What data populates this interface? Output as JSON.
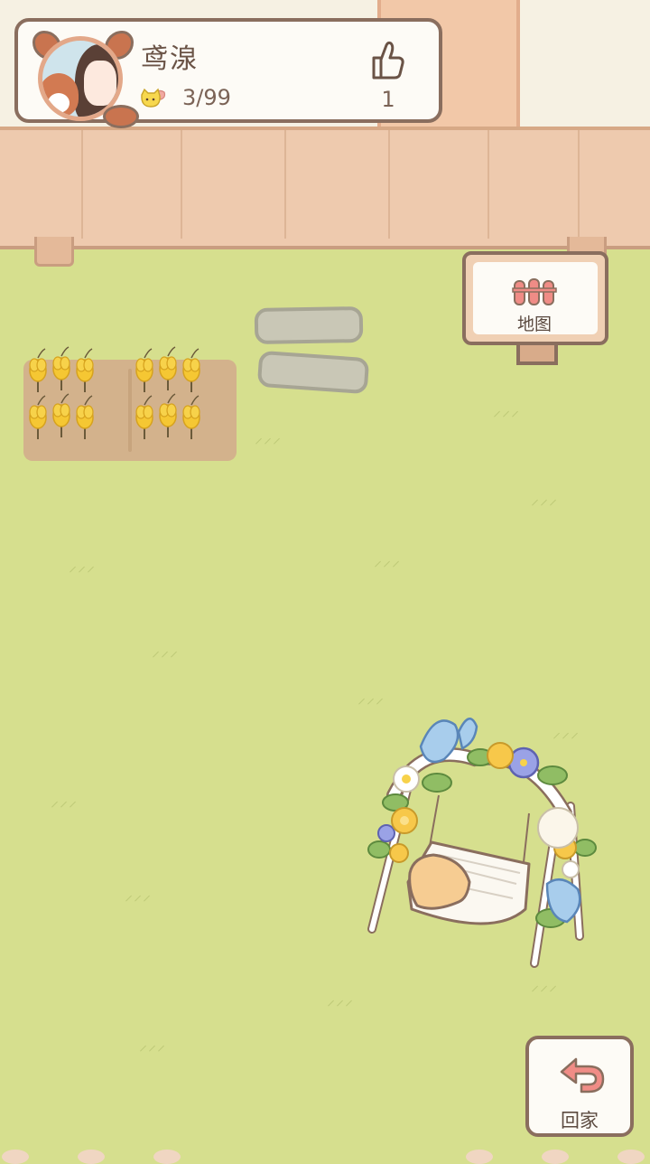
{
  "player": {
    "name": "鸢湶",
    "capacity": "3/99",
    "likes": "1"
  },
  "map_sign": {
    "label": "地图"
  },
  "home_button": {
    "label": "回家"
  },
  "icons": {
    "avatar": "avatar-girl-fox",
    "capacity": "cat-icon",
    "likes": "thumbs-up-icon",
    "map": "fence-map-icon",
    "home": "return-arrow-icon"
  },
  "colors": {
    "grass": "#d6df8e",
    "outline": "#8a6e5e",
    "fence": "#eecaae",
    "card": "#fdfbf6",
    "accent_pink": "#f08c86"
  }
}
